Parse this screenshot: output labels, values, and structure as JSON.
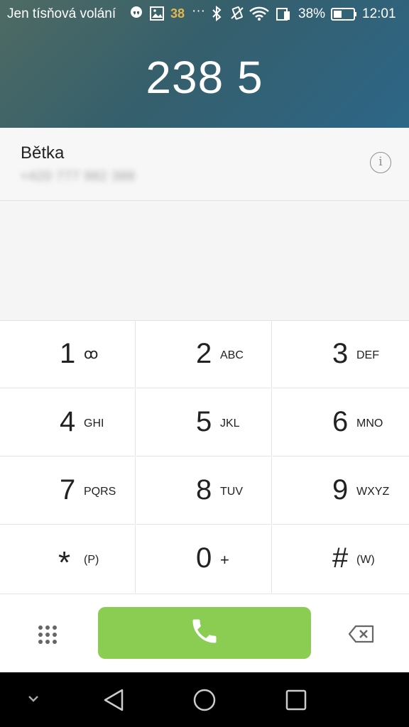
{
  "status_bar": {
    "carrier": "Jen tísňová volání",
    "temperature": "38",
    "more": "···",
    "battery_percent": "38%",
    "time": "12:01",
    "icons": [
      "hangouts-icon",
      "gallery-icon",
      "weather-icon",
      "bluetooth-icon",
      "vibrate-icon",
      "wifi-icon",
      "sim-icon",
      "battery-icon"
    ]
  },
  "dial": {
    "number": "238 5"
  },
  "suggestion": {
    "name": "Bětka",
    "phone": "+420 777 982 388",
    "info_label": "i"
  },
  "keypad": [
    {
      "digit": "1",
      "letters": "ꝏ"
    },
    {
      "digit": "2",
      "letters": "ABC"
    },
    {
      "digit": "3",
      "letters": "DEF"
    },
    {
      "digit": "4",
      "letters": "GHI"
    },
    {
      "digit": "5",
      "letters": "JKL"
    },
    {
      "digit": "6",
      "letters": "MNO"
    },
    {
      "digit": "7",
      "letters": "PQRS"
    },
    {
      "digit": "8",
      "letters": "TUV"
    },
    {
      "digit": "9",
      "letters": "WXYZ"
    },
    {
      "digit": "*",
      "letters": "(P)"
    },
    {
      "digit": "0",
      "letters": "+"
    },
    {
      "digit": "#",
      "letters": "(W)"
    }
  ],
  "colors": {
    "call_button": "#8acd52",
    "header": "#2d6687",
    "temperature": "#e2b64f"
  }
}
